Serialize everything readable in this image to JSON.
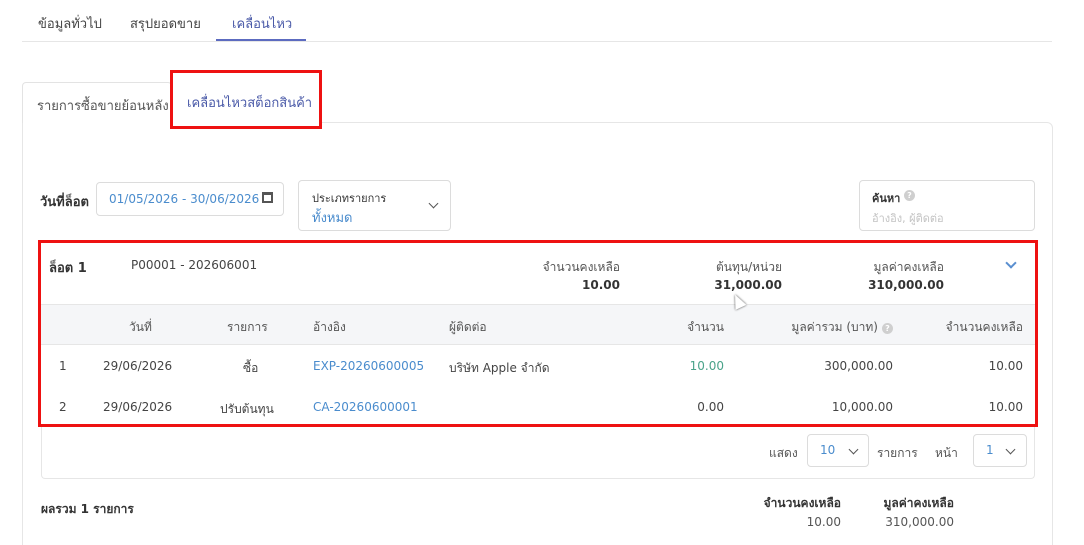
{
  "top_tabs": [
    {
      "label": "ข้อมูลทั่วไป"
    },
    {
      "label": "สรุปยอดขาย"
    },
    {
      "label": "เคลื่อนไหว"
    }
  ],
  "sub_tabs": [
    {
      "label": "รายการซื้อขายย้อนหลัง"
    },
    {
      "label": "เคลื่อนไหวสต็อกสินค้า"
    }
  ],
  "filters": {
    "date_label": "วันที่ล็อต",
    "date_range": "01/05/2026 - 30/06/2026",
    "type_label": "ประเภทรายการ",
    "type_value": "ทั้งหมด",
    "search_label": "ค้นหา",
    "search_placeholder": "อ้างอิง, ผู้ติดต่อ"
  },
  "lot": {
    "title": "ล็อต 1",
    "code": "P00001 - 202606001",
    "summary": [
      {
        "label": "จำนวนคงเหลือ",
        "value": "10.00"
      },
      {
        "label": "ต้นทุน/หน่วย",
        "value": "31,000.00"
      },
      {
        "label": "มูลค่าคงเหลือ",
        "value": "310,000.00"
      }
    ],
    "columns": [
      "วันที่",
      "รายการ",
      "อ้างอิง",
      "ผู้ติดต่อ",
      "จำนวน",
      "มูลค่ารวม (บาท)",
      "จำนวนคงเหลือ"
    ],
    "rows": [
      {
        "no": "1",
        "date": "29/06/2026",
        "type": "ซื้อ",
        "ref": "EXP-20260600005",
        "contact": "บริษัท Apple จำกัด",
        "qty": "10.00",
        "amount": "300,000.00",
        "balance": "10.00"
      },
      {
        "no": "2",
        "date": "29/06/2026",
        "type": "ปรับต้นทุน",
        "ref": "CA-20260600001",
        "contact": "",
        "qty": "0.00",
        "amount": "10,000.00",
        "balance": "10.00"
      }
    ]
  },
  "pagination": {
    "show_label": "แสดง",
    "page_size": "10",
    "items_label": "รายการ",
    "page_label": "หน้า",
    "page": "1"
  },
  "totals": {
    "label": "ผลรวม 1 รายการ",
    "qty_header": "จำนวนคงเหลือ",
    "qty_value": "10.00",
    "value_header": "มูลค่าคงเหลือ",
    "value_value": "310,000.00"
  },
  "colors": {
    "accent": "#4a5aa8",
    "link": "#4a8ccd",
    "highlight": "#ee1111"
  }
}
